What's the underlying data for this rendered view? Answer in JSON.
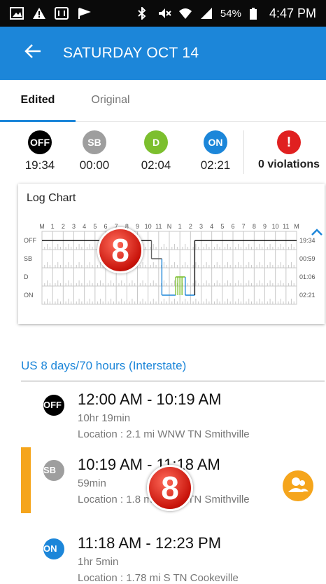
{
  "statusbar": {
    "battery": "54%",
    "time": "4:47 PM"
  },
  "appbar": {
    "back_icon": "arrow-left-icon",
    "title": "SATURDAY OCT 14"
  },
  "tabs": [
    {
      "label": "Edited",
      "selected": true
    },
    {
      "label": "Original",
      "selected": false
    }
  ],
  "summary": {
    "stats": [
      {
        "code": "OFF",
        "time": "19:34",
        "color": "#000000"
      },
      {
        "code": "SB",
        "time": "00:00",
        "color": "#9e9e9e"
      },
      {
        "code": "D",
        "time": "02:04",
        "color": "#7cbf2e"
      },
      {
        "code": "ON",
        "time": "02:21",
        "color": "#1c86d9"
      }
    ],
    "violations": {
      "icon": "!",
      "label": "0 violations",
      "color": "#e02020"
    }
  },
  "log_chart": {
    "title": "Log Chart",
    "hour_labels": [
      "M",
      "1",
      "2",
      "3",
      "4",
      "5",
      "6",
      "7",
      "8",
      "9",
      "10",
      "11",
      "N",
      "1",
      "2",
      "3",
      "4",
      "5",
      "6",
      "7",
      "8",
      "9",
      "10",
      "11",
      "M"
    ],
    "rows": [
      {
        "label": "OFF",
        "total": "19:34"
      },
      {
        "label": "SB",
        "total": "00:59"
      },
      {
        "label": "D",
        "total": "01:06"
      },
      {
        "label": "ON",
        "total": "02:21"
      }
    ]
  },
  "watermark": {
    "text": "8"
  },
  "section_title": "US 8 days/70 hours (Interstate)",
  "events": [
    {
      "code": "OFF",
      "color": "#000000",
      "range": "12:00 AM - 10:19 AM",
      "duration": "10hr 19min",
      "location": "Location : 2.1 mi WNW TN Smithville"
    },
    {
      "code": "SB",
      "color": "#9e9e9e",
      "range": "10:19 AM - 11:18 AM",
      "duration": "59min",
      "location": "Location : 1.8 mi WNW TN Smithville"
    },
    {
      "code": "ON",
      "color": "#1c86d9",
      "range": "11:18 AM - 12:23 PM",
      "duration": "1hr 5min",
      "location": "Location : 1.78 mi S TN Cookeville"
    }
  ],
  "colors": {
    "accent": "#1c86d9",
    "selected": "#f5a51c"
  }
}
